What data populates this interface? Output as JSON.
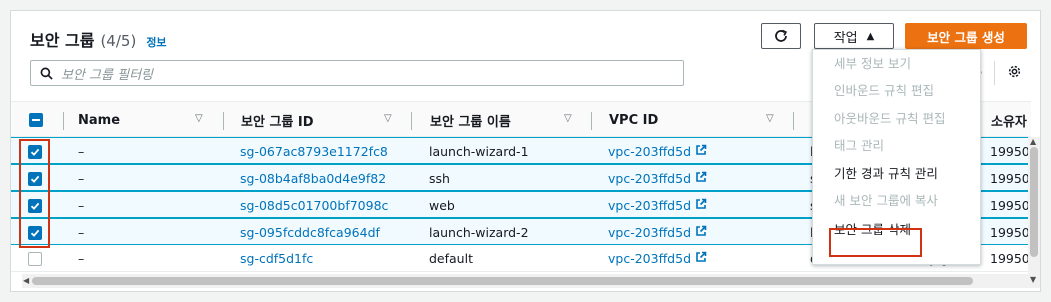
{
  "header": {
    "title": "보안 그룹",
    "count": "(4/5)",
    "info_link": "정보"
  },
  "toolbar": {
    "refresh_icon": "refresh-icon",
    "actions_label": "작업",
    "create_label": "보안 그룹 생성"
  },
  "search": {
    "placeholder": "보안 그룹 필터링"
  },
  "table": {
    "columns": {
      "name": "Name",
      "sg_id": "보안 그룹 ID",
      "sg_name": "보안 그룹 이름",
      "vpc_id": "VPC ID",
      "owner": "소유자"
    },
    "rows": [
      {
        "selected": true,
        "name": "–",
        "sg_id": "sg-067ac8793e1172fc8",
        "sg_name": "launch-wizard-1",
        "vpc_id": "vpc-203ffd5d",
        "desc": "l",
        "owner": "19950"
      },
      {
        "selected": true,
        "name": "–",
        "sg_id": "sg-08b4af8ba0d4e9f82",
        "sg_name": "ssh",
        "vpc_id": "vpc-203ffd5d",
        "desc": "s",
        "owner": "19950"
      },
      {
        "selected": true,
        "name": "–",
        "sg_id": "sg-08d5c01700bf7098c",
        "sg_name": "web",
        "vpc_id": "vpc-203ffd5d",
        "desc": "s",
        "owner": "19950"
      },
      {
        "selected": true,
        "name": "–",
        "sg_id": "sg-095fcddc8fca964df",
        "sg_name": "launch-wizard-2",
        "vpc_id": "vpc-203ffd5d",
        "desc": "l",
        "owner": "19950"
      },
      {
        "selected": false,
        "name": "–",
        "sg_id": "sg-cdf5d1fc",
        "sg_name": "default",
        "vpc_id": "vpc-203ffd5d",
        "desc": "default VPC security gr…",
        "owner": "19950"
      }
    ]
  },
  "actions_menu": {
    "items": [
      {
        "label": "세부 정보 보기",
        "enabled": false
      },
      {
        "label": "인바운드 규칙 편집",
        "enabled": false
      },
      {
        "label": "아웃바운드 규칙 편집",
        "enabled": false
      },
      {
        "label": "태그 관리",
        "enabled": false
      },
      {
        "label": "기한 경과 규칙 관리",
        "enabled": true
      },
      {
        "label": "새 보안 그룹에 복사",
        "enabled": false
      },
      {
        "label": "보안 그룹 삭제",
        "enabled": true,
        "highlighted": true
      }
    ]
  },
  "colors": {
    "link": "#0073bb",
    "primary_button": "#ec7211",
    "highlight_box": "#d13212",
    "selected_row": "#f1faff"
  }
}
